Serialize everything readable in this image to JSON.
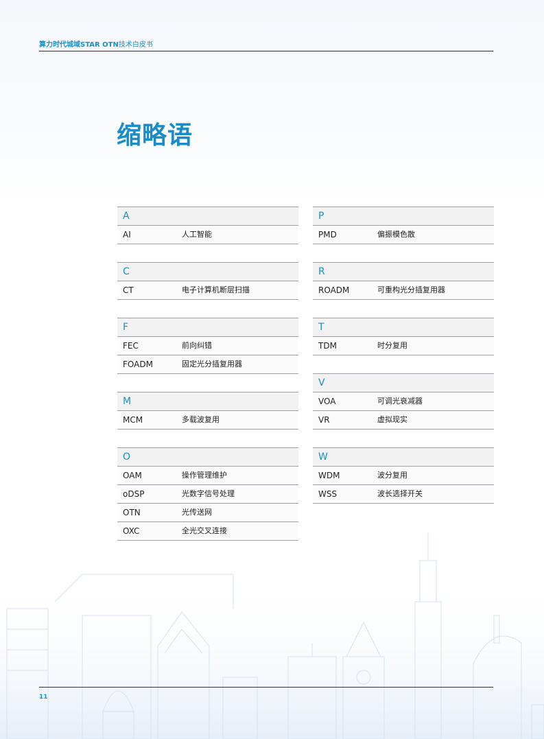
{
  "header": {
    "title_bold": "算力时代城域STAR OTN",
    "title_rest": "技术白皮书"
  },
  "page": {
    "title": "缩略语",
    "number": "11"
  },
  "colors": {
    "accent": "#1a8fc9",
    "rule": "#9aa0a6",
    "header_bg": "#f2f2f2"
  },
  "glossary": {
    "left": [
      {
        "letter": "A",
        "entries": [
          {
            "abbr": "AI",
            "meaning": "人工智能"
          }
        ]
      },
      {
        "letter": "C",
        "entries": [
          {
            "abbr": "CT",
            "meaning": "电子计算机断层扫描"
          }
        ]
      },
      {
        "letter": "F",
        "entries": [
          {
            "abbr": "FEC",
            "meaning": "前向纠错"
          },
          {
            "abbr": "FOADM",
            "meaning": "固定光分插复用器"
          }
        ]
      },
      {
        "letter": "M",
        "entries": [
          {
            "abbr": "MCM",
            "meaning": "多载波复用"
          }
        ]
      },
      {
        "letter": "O",
        "entries": [
          {
            "abbr": "OAM",
            "meaning": "操作管理维护"
          },
          {
            "abbr": "oDSP",
            "meaning": "光数字信号处理"
          },
          {
            "abbr": "OTN",
            "meaning": "光传送网"
          },
          {
            "abbr": "OXC",
            "meaning": "全光交叉连接"
          }
        ]
      }
    ],
    "right": [
      {
        "letter": "P",
        "entries": [
          {
            "abbr": "PMD",
            "meaning": "偏振模色散"
          }
        ]
      },
      {
        "letter": "R",
        "entries": [
          {
            "abbr": "ROADM",
            "meaning": "可重构光分插复用器"
          }
        ]
      },
      {
        "letter": "T",
        "entries": [
          {
            "abbr": "TDM",
            "meaning": "时分复用"
          }
        ]
      },
      {
        "letter": "V",
        "entries": [
          {
            "abbr": "VOA",
            "meaning": "可调光衰减器"
          },
          {
            "abbr": "VR",
            "meaning": "虚拟现实"
          }
        ]
      },
      {
        "letter": "W",
        "entries": [
          {
            "abbr": "WDM",
            "meaning": "波分复用"
          },
          {
            "abbr": "WSS",
            "meaning": "波长选择开关"
          }
        ]
      }
    ]
  }
}
